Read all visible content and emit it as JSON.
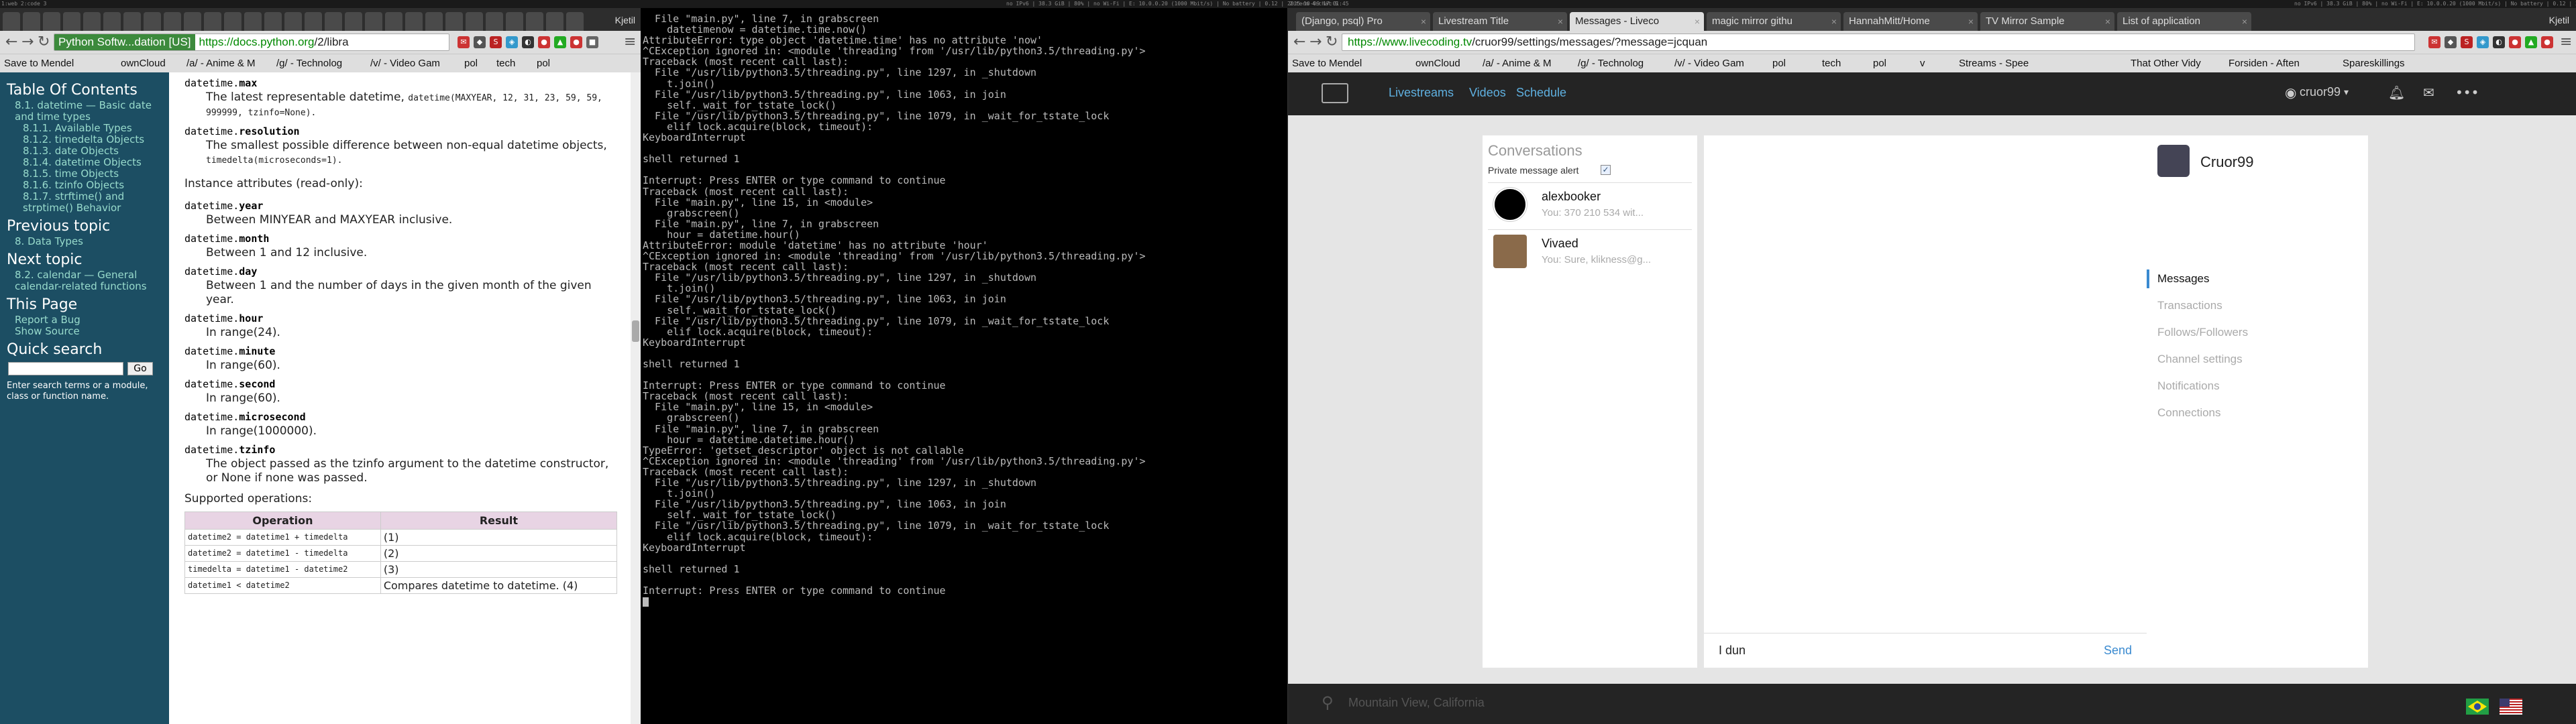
{
  "status_left": "1:web  2:code  3",
  "status_mid_left": "no IPv6 | 38.3 GiB | 80% | no Wi-Fi | E: 10.0.0.20 (1000 Mbit/s) | No battery | 0.12 | 2015-10-09 17:01:45",
  "status_mid_right": "2:term  4:chat  5",
  "status_right": "no IPv6 | 38.3 GiB | 80% | no Wi-Fi | E: 10.0.0.20 (1000 Mbit/s) | No battery | 0.12 | 2015-10-09 17:01:45",
  "left_browser": {
    "active_tab": "Python Softw...dation [US]",
    "url_host": "https://docs.python.org",
    "url_rest": "/2/libra",
    "window_user": "Kjetil",
    "bookmarks": [
      "Save to Mendel",
      "ownCloud",
      "/a/ - Anime & M",
      "/g/ - Technolog",
      "/v/ - Video Gam",
      "pol",
      "tech",
      "pol"
    ]
  },
  "docs": {
    "toc_title": "Table Of Contents",
    "toc": [
      {
        "text": "8.1. datetime — Basic date and time types"
      },
      {
        "text": "8.1.1. Available Types"
      },
      {
        "text": "8.1.2. timedelta Objects"
      },
      {
        "text": "8.1.3. date Objects"
      },
      {
        "text": "8.1.4. datetime Objects"
      },
      {
        "text": "8.1.5. time Objects"
      },
      {
        "text": "8.1.6. tzinfo Objects"
      },
      {
        "text": "8.1.7. strftime() and strptime() Behavior"
      }
    ],
    "prev_title": "Previous topic",
    "prev_link": "8. Data Types",
    "next_title": "Next topic",
    "next_link": "8.2. calendar — General calendar-related functions",
    "thispage_title": "This Page",
    "report_bug": "Report a Bug",
    "show_source": "Show Source",
    "quick_search_title": "Quick search",
    "go": "Go",
    "search_note": "Enter search terms or a module, class or function name.",
    "attrs": [
      {
        "prefix": "datetime.",
        "name": "max",
        "desc": "The latest representable datetime,",
        "code": "datetime(MAXYEAR, 12, 31, 23, 59, 59, 999999, tzinfo=None)."
      },
      {
        "prefix": "datetime.",
        "name": "resolution",
        "desc": "The smallest possible difference between non-equal datetime objects,",
        "code": "timedelta(microseconds=1)."
      }
    ],
    "instance_heading": "Instance attributes (read-only):",
    "inst": [
      {
        "prefix": "datetime.",
        "name": "year",
        "desc": "Between MINYEAR and MAXYEAR inclusive."
      },
      {
        "prefix": "datetime.",
        "name": "month",
        "desc": "Between 1 and 12 inclusive."
      },
      {
        "prefix": "datetime.",
        "name": "day",
        "desc": "Between 1 and the number of days in the given month of the given year."
      },
      {
        "prefix": "datetime.",
        "name": "hour",
        "desc": "In range(24)."
      },
      {
        "prefix": "datetime.",
        "name": "minute",
        "desc": "In range(60)."
      },
      {
        "prefix": "datetime.",
        "name": "second",
        "desc": "In range(60)."
      },
      {
        "prefix": "datetime.",
        "name": "microsecond",
        "desc": "In range(1000000)."
      },
      {
        "prefix": "datetime.",
        "name": "tzinfo",
        "desc": "The object passed as the tzinfo argument to the datetime constructor, or None if none was passed."
      }
    ],
    "supported": "Supported operations:",
    "table_headers": [
      "Operation",
      "Result"
    ],
    "table_rows": [
      [
        "datetime2 = datetime1 + timedelta",
        "(1)"
      ],
      [
        "datetime2 = datetime1 - timedelta",
        "(2)"
      ],
      [
        "timedelta = datetime1 - datetime2",
        "(3)"
      ],
      [
        "datetime1 < datetime2",
        "Compares datetime to datetime. (4)"
      ]
    ]
  },
  "terminal": {
    "lines": [
      "  File \"main.py\", line 7, in grabscreen",
      "    datetimenow = datetime.time.now()",
      "AttributeError: type object 'datetime.time' has no attribute 'now'",
      "^CException ignored in: <module 'threading' from '/usr/lib/python3.5/threading.py'>",
      "Traceback (most recent call last):",
      "  File \"/usr/lib/python3.5/threading.py\", line 1297, in _shutdown",
      "    t.join()",
      "  File \"/usr/lib/python3.5/threading.py\", line 1063, in join",
      "    self._wait_for_tstate_lock()",
      "  File \"/usr/lib/python3.5/threading.py\", line 1079, in _wait_for_tstate_lock",
      "    elif lock.acquire(block, timeout):",
      "KeyboardInterrupt",
      "",
      "shell returned 1",
      "",
      "Interrupt: Press ENTER or type command to continue",
      "Traceback (most recent call last):",
      "  File \"main.py\", line 15, in <module>",
      "    grabscreen()",
      "  File \"main.py\", line 7, in grabscreen",
      "    hour = datetime.hour()",
      "AttributeError: module 'datetime' has no attribute 'hour'",
      "^CException ignored in: <module 'threading' from '/usr/lib/python3.5/threading.py'>",
      "Traceback (most recent call last):",
      "  File \"/usr/lib/python3.5/threading.py\", line 1297, in _shutdown",
      "    t.join()",
      "  File \"/usr/lib/python3.5/threading.py\", line 1063, in join",
      "    self._wait_for_tstate_lock()",
      "  File \"/usr/lib/python3.5/threading.py\", line 1079, in _wait_for_tstate_lock",
      "    elif lock.acquire(block, timeout):",
      "KeyboardInterrupt",
      "",
      "shell returned 1",
      "",
      "Interrupt: Press ENTER or type command to continue",
      "Traceback (most recent call last):",
      "  File \"main.py\", line 15, in <module>",
      "    grabscreen()",
      "  File \"main.py\", line 7, in grabscreen",
      "    hour = datetime.datetime.hour()",
      "TypeError: 'getset_descriptor' object is not callable",
      "^CException ignored in: <module 'threading' from '/usr/lib/python3.5/threading.py'>",
      "Traceback (most recent call last):",
      "  File \"/usr/lib/python3.5/threading.py\", line 1297, in _shutdown",
      "    t.join()",
      "  File \"/usr/lib/python3.5/threading.py\", line 1063, in join",
      "    self._wait_for_tstate_lock()",
      "  File \"/usr/lib/python3.5/threading.py\", line 1079, in _wait_for_tstate_lock",
      "    elif lock.acquire(block, timeout):",
      "KeyboardInterrupt",
      "",
      "shell returned 1",
      "",
      "Interrupt: Press ENTER or type command to continue"
    ]
  },
  "right_browser": {
    "tabs": [
      "(Django, psql) Pro",
      "Livestream Title",
      "Messages - Liveco",
      "magic mirror githu",
      "HannahMitt/Home",
      "TV Mirror Sample",
      "List of application"
    ],
    "url_host": "https://www.livecoding.tv",
    "url_rest": "/cruor99/settings/messages/?message=jcquan",
    "window_user": "Kjetil",
    "bookmarks": [
      "Save to Mendel",
      "ownCloud",
      "/a/ - Anime & M",
      "/g/ - Technolog",
      "/v/ - Video Gam",
      "pol",
      "tech",
      "pol",
      "v",
      "Streams - Spee",
      "That Other Vidy",
      "Forsiden - Aften",
      "Spareskillings"
    ]
  },
  "lc": {
    "nav": [
      "Livestreams",
      "Videos",
      "Schedule"
    ],
    "user": "cruor99",
    "conversations_title": "Conversations",
    "alert_label": "Private message alert",
    "conversations": [
      {
        "name": "alexbooker",
        "preview": "You: 370 210 534 wit..."
      },
      {
        "name": "Vivaed",
        "preview": "You: Sure, klikness@g..."
      }
    ],
    "message_value": "I dun",
    "send": "Send",
    "profile_name": "Cruor99",
    "menu": [
      "Messages",
      "Transactions",
      "Follows/Followers",
      "Channel settings",
      "Notifications",
      "Connections"
    ],
    "footer_location": "Mountain View, California"
  }
}
